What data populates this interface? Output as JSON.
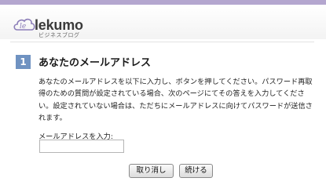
{
  "header": {
    "logo_name": "lekumo",
    "logo_subtitle": "ビジネスブログ",
    "logo_icon": "cloud-logo-icon",
    "bar_color": "#b4a6cf"
  },
  "step": {
    "number": "1",
    "title": "あなたのメールアドレス",
    "badge_color": "#6f92c1"
  },
  "instructions": "あなたのメールアドレスを以下に入力し、ボタンを押してください。パスワード再取得のための質問が設定されている場合、次のページにてその答えを入力してください。設定されていない場合は、ただちにメールアドレスに向けてパスワードが送信されます。",
  "email": {
    "label": "メールアドレスを入力:",
    "value": "",
    "placeholder": ""
  },
  "buttons": {
    "cancel": "取り消し",
    "continue": "続ける"
  }
}
